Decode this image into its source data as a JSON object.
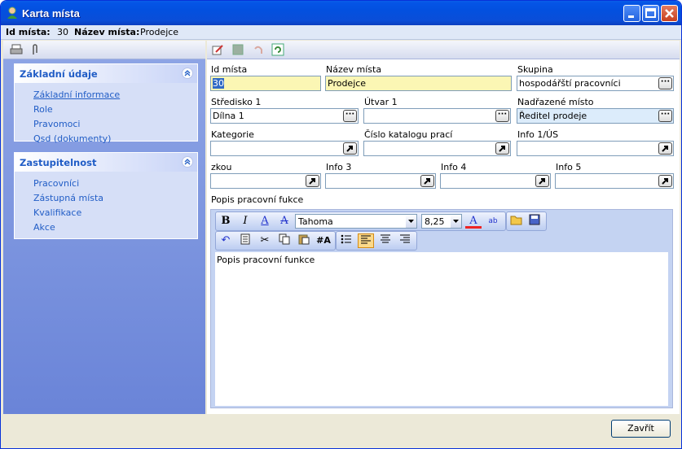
{
  "window": {
    "title": "Karta místa"
  },
  "info": {
    "id_label": "Id místa:",
    "id_value": "30",
    "name_label": "Název místa:",
    "name_value": "Prodejce"
  },
  "sidebar": {
    "panels": [
      {
        "title": "Základní údaje",
        "items": [
          "Základní informace",
          "Role",
          "Pravomoci",
          "Qsd (dokumenty)"
        ]
      },
      {
        "title": "Zastupitelnost",
        "items": [
          "Pracovníci",
          "Zástupná místa",
          "Kvalifikace",
          "Akce"
        ]
      }
    ]
  },
  "form": {
    "id_label": "Id místa",
    "id_value": "30",
    "name_label": "Název místa",
    "name_value": "Prodejce",
    "group_label": "Skupina",
    "group_value": "hospodářští pracovníci",
    "center_label": "Středisko 1",
    "center_value": "Dílna 1",
    "unit_label": "Útvar 1",
    "unit_value": "",
    "superior_label": "Nadřazené místo",
    "superior_value": "Ředitel prodeje",
    "category_label": "Kategorie",
    "category_value": "",
    "catalog_label": "Číslo katalogu prací",
    "catalog_value": "",
    "info1_label": "Info 1/ÚS",
    "info1_value": "",
    "abbr_label": "zkou",
    "abbr_value": "",
    "info3_label": "Info 3",
    "info3_value": "",
    "info4_label": "Info 4",
    "info4_value": "",
    "info5_label": "Info 5",
    "info5_value": "",
    "description_label": "Popis pracovní fukce"
  },
  "editor": {
    "font": "Tahoma",
    "size": "8,25",
    "content": "Popis pracovní funkce"
  },
  "buttons": {
    "close": "Zavřít"
  },
  "icons": [
    "user-icon",
    "minimize-icon",
    "maximize-icon",
    "close-icon",
    "print-icon",
    "attach-icon",
    "edit-icon",
    "save-icon",
    "undo-icon",
    "refresh-icon",
    "ellipsis-icon",
    "jump-arrow-icon"
  ]
}
